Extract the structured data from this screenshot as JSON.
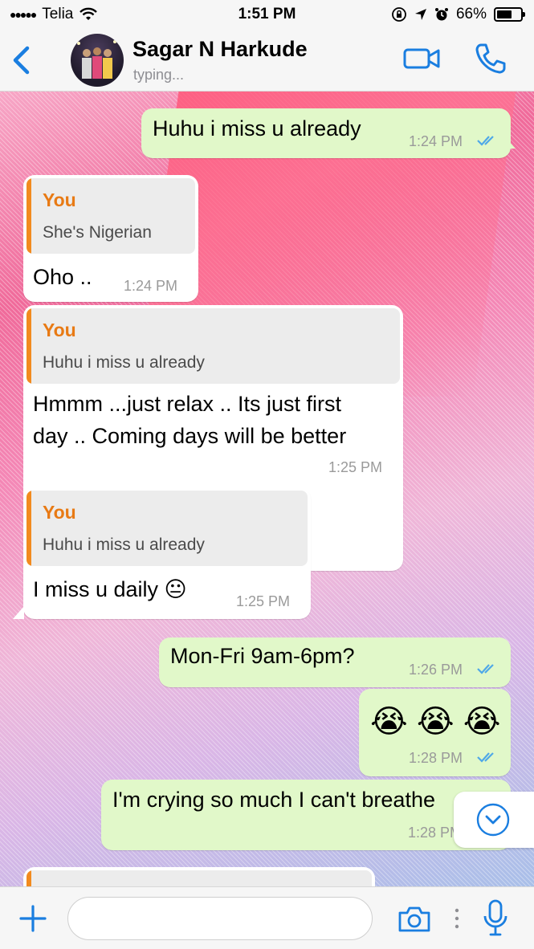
{
  "status_bar": {
    "carrier": "Telia",
    "signal_dots": "●●●●●",
    "time": "1:51 PM",
    "battery_percent": "66%",
    "battery_level": 0.66
  },
  "header": {
    "contact_name": "Sagar N Harkude",
    "status": "typing..."
  },
  "colors": {
    "accent": "#1a7ee0",
    "outgoing_bubble": "#e1f8c9",
    "incoming_bubble": "#ffffff",
    "quote_author": "#e87a14",
    "read_ticks": "#4fa8e8"
  },
  "messages": [
    {
      "direction": "out",
      "text": "Huhu i miss u already",
      "time": "1:24 PM",
      "read": true
    },
    {
      "direction": "in",
      "quote_author": "You",
      "quote_text": "She's Nigerian",
      "text": "Oho ..",
      "time": "1:24 PM"
    },
    {
      "direction": "in",
      "quote_author": "You",
      "quote_text": "Huhu i miss u already",
      "text_line1": "Hmmm ...just relax .. Its just first",
      "text_line2": "day .. Coming days will be better",
      "time": "1:25 PM"
    },
    {
      "direction": "in",
      "quote_author": "You",
      "quote_text": "Huhu i miss u already",
      "text": "I miss u daily 😐",
      "time": "1:25 PM"
    },
    {
      "direction": "out",
      "text": "Mon-Fri 9am-6pm?",
      "time": "1:26 PM",
      "read": true
    },
    {
      "direction": "out",
      "text": "😭 😭 😭",
      "time": "1:28 PM",
      "read": true
    },
    {
      "direction": "out",
      "text": "I'm crying so much I can't breathe",
      "time": "1:28 PM",
      "read": true
    }
  ],
  "input": {
    "value": ""
  }
}
